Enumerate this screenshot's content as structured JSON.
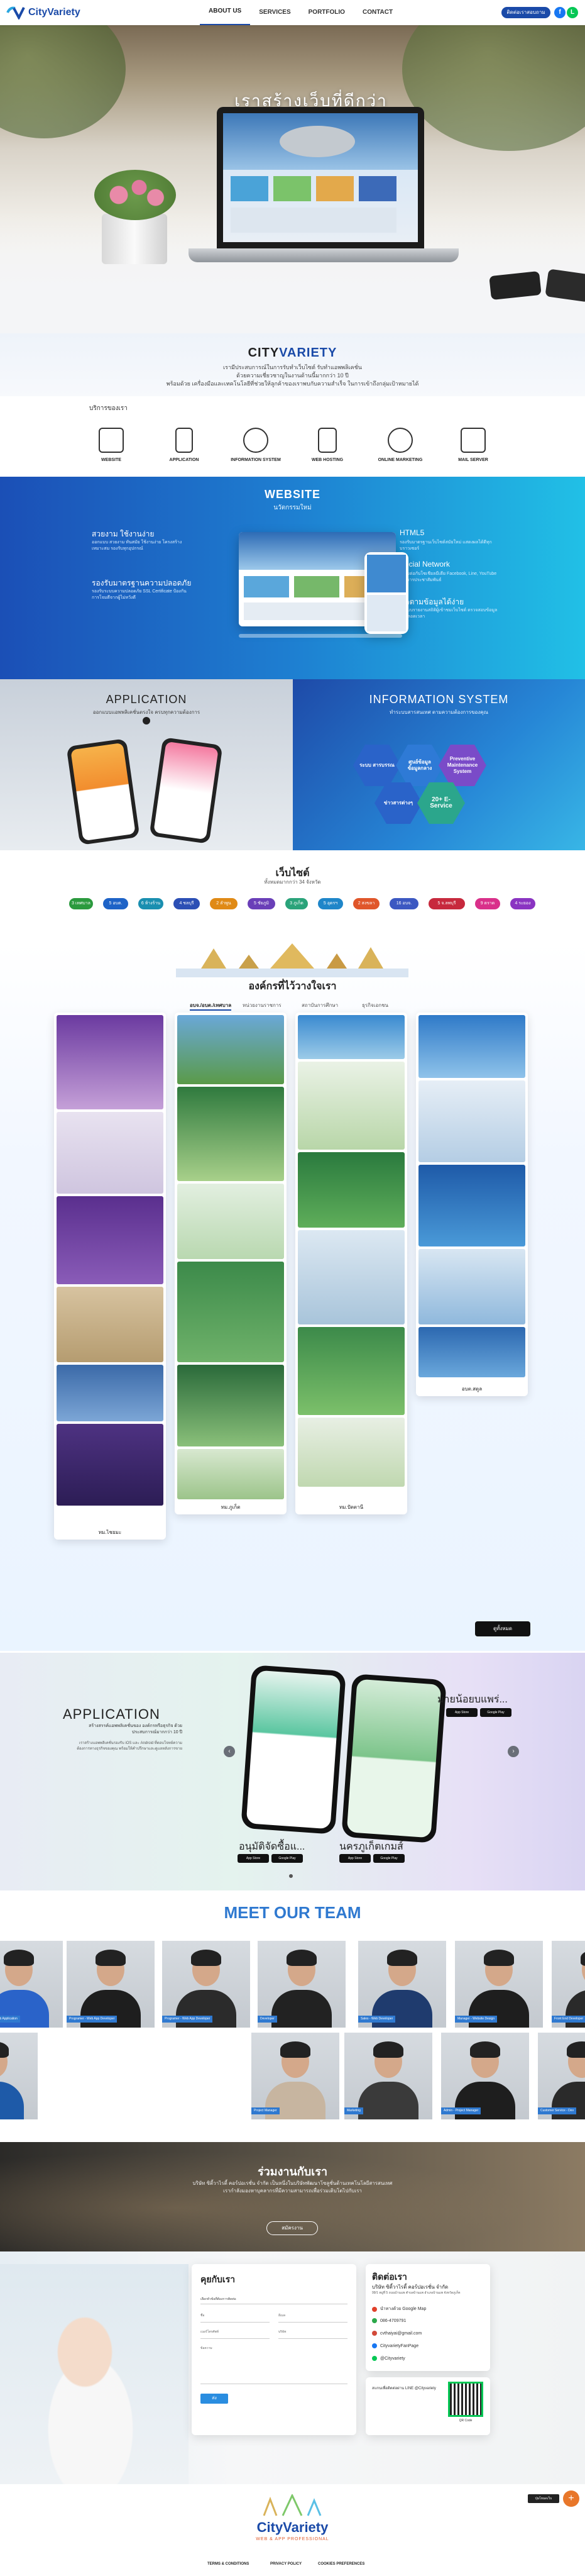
{
  "brand": {
    "logo_text": "CityVariety",
    "accent": "#1a4aa8"
  },
  "nav": {
    "items": [
      "ABOUT US",
      "SERVICES",
      "PORTFOLIO",
      "CONTACT"
    ],
    "contact_button": "ติดต่อเราสอบถาม",
    "social": [
      "f",
      "L",
      "m"
    ]
  },
  "hero": {
    "title": "เราสร้างเว็บที่ดีกว่า"
  },
  "about": {
    "title_city": "CITY",
    "title_variety": "VARIETY",
    "lines": [
      "เรามีประสบการณ์ในการรับทำเว็บไซต์ รับทำแอพพลิเคชั่น",
      "ด้วยความเชี่ยวชาญในงานด้านนี้มากกว่า 10 ปี",
      "พร้อมด้วย เครื่องมือและเทคโนโลยีที่ช่วยให้ลูกค้าของเราพบกับความสำเร็จ ในการเข้าถึงกลุ่มเป้าหมายได้"
    ]
  },
  "services": {
    "title": "บริการของเรา",
    "items": [
      "WEBSITE",
      "APPLICATION",
      "INFORMATION SYSTEM",
      "WEB HOSTING",
      "ONLINE MARKETING",
      "MAIL SERVER"
    ]
  },
  "website": {
    "title": "WEBSITE",
    "subtitle": "นวัตกรรมใหม่",
    "left": [
      {
        "h": "สวยงาม ใช้งานง่าย",
        "p": "ออกแบบ สวยงาม ทันสมัย ใช้งานง่าย โครงสร้างเหมาะสม รองรับทุกอุปกรณ์"
      },
      {
        "h": "รองรับมาตรฐานความปลอดภัย",
        "p": "รองรับระบบความปลอดภัย SSL Certificate ป้องกันการโจมตีจากผู้ไม่หวังดี"
      }
    ],
    "right": [
      {
        "h": "HTML5",
        "p": "รองรับมาตรฐานเว็บไซต์สมัยใหม่ แสดงผลได้ดีทุกบราวเซอร์"
      },
      {
        "h": "Social Network",
        "p": "เชื่อมต่อกับโซเชียลมีเดีย Facebook, Line, YouTube เพื่อการประชาสัมพันธ์"
      },
      {
        "h": "ติดตามข้อมูลได้ง่าย",
        "p": "มีระบบรายงานสถิติผู้เข้าชมเว็บไซต์ ตรวจสอบข้อมูลได้ตลอดเวลา"
      }
    ]
  },
  "application": {
    "title": "APPLICATION",
    "subtitle": "ออกแบบแอพพลิเคชั่นตรงใจ ครบทุกความต้องการ"
  },
  "information": {
    "title": "INFORMATION SYSTEM",
    "subtitle": "ทำระบบสารสนเทศ ตามความต้องการของคุณ",
    "hexes": [
      "ระบบ สารบรรณ",
      "ศูนย์ข้อมูล ข้อมูลกลาง",
      "Preventive Maintenance System",
      "ข่าวสารต่างๆ",
      "20+ E-Service"
    ]
  },
  "websites": {
    "title": "เว็บไซต์",
    "subtitle": "ทั้งหมดมากกว่า 34 จังหวัด",
    "pills": [
      {
        "label": "3 เทศบาล",
        "color": "#2b9a3e"
      },
      {
        "label": "5 อบต.",
        "color": "#1e63c7"
      },
      {
        "label": "6 ห้างร้าน",
        "color": "#1a8fb0"
      },
      {
        "label": "4 ชลบุรี",
        "color": "#2c4fb5"
      },
      {
        "label": "2 ลำพูน",
        "color": "#e08a16"
      },
      {
        "label": "5 ชัยภูมิ",
        "color": "#6a3fb8"
      },
      {
        "label": "3 ภูเก็ต",
        "color": "#2aa37a"
      },
      {
        "label": "5 อุดรฯ",
        "color": "#1f86c9"
      },
      {
        "label": "2 สงขลา",
        "color": "#e0562a"
      },
      {
        "label": "16 อบจ.",
        "color": "#3c58c2"
      },
      {
        "label": "5 จ.ลพบุรี",
        "color": "#c7293d"
      },
      {
        "label": "9 ตราด",
        "color": "#d9308a"
      },
      {
        "label": "4 ระยอง",
        "color": "#8a34c2"
      }
    ]
  },
  "orgs": {
    "title": "องค์กรที่ไว้วางใจเรา",
    "tabs": [
      "อบจ./อบต./เทศบาล",
      "หน่วยงานราชการ",
      "สถาบันการศึกษา",
      "ธุรกิจเอกชน"
    ],
    "cards": [
      "ทม.ไชยมะ",
      "ทม.ภูเก็ต",
      "ทม.ปัตตานี",
      "อบต.สตูล"
    ],
    "more_button": "ดูทั้งหมด"
  },
  "app_banner": {
    "title": "APPLICATION",
    "subtitle": "สร้างสรรค์แอพพลิเคชั่นของ องค์กรหรือธุรกิจ ด้วยประสบการณ์มากกว่า 10 ปี",
    "body": "เราสร้างแอพพลิเคชั่นรองรับ iOS และ Android ที่ตอบโจทย์ความต้องการทางธุรกิจของคุณ พร้อมให้คำปรึกษาและดูแลหลังการขาย",
    "app1": "อนุมัติจัดซื้อแ...",
    "app2": "นครภูเก็ตเกมส์",
    "app3": "มายน้อยบแพร่...",
    "store_ios": "App Store",
    "store_play": "Google Play"
  },
  "team": {
    "title": "MEET OUR TEAM",
    "roles": [
      "Programer - Web Application",
      "Programer - Web App Developer",
      "Programer - Web App Developer",
      "Developer",
      "Sales - Web Developer",
      "Manager - Website Design",
      "Front End Developer",
      "Project Manager",
      "Project Manager",
      "Marketing",
      "Admin - Project Manager",
      "Customer Service - Dev",
      "Web Developer"
    ]
  },
  "join": {
    "title": "ร่วมงานกับเรา",
    "text": "บริษัท ซิตี้วาไรตี้ คอร์ปอเรชั่น จำกัด เป็นหนึ่งในบริษัทพัฒนาโซลูชั่นด้านเทคโนโลยีสารสนเทศ เรากำลังมองหาบุคลากรที่มีความสามารถเพื่อร่วมเติบโตไปกับเรา",
    "button": "สมัครงาน"
  },
  "contact": {
    "form_title": "คุยกับเรา",
    "fields": [
      "เลือกหัวข้อที่ต้องการติดต่อ",
      "ชื่อ",
      "อีเมล",
      "เบอร์โทรศัพท์",
      "บริษัท",
      "ข้อความ"
    ],
    "send": "ส่ง",
    "info_title": "ติดต่อเรา",
    "company": "บริษัท ซิตี้วาไรตี้ คอร์ปอเรชั่น จำกัด",
    "address": "99/1 หมู่ที่ 5 ถนนบ้านแพ ตำบลบ้านแพ อำเภอบ้านแพ จังหวัดภูเก็ต",
    "map": "นำทางด้วย Google Map",
    "phone": "086-4709791",
    "email": "cvthaiyai@gmail.com",
    "facebook": "CityvarietyFanPage",
    "line": "@Cityvariety",
    "qr_text": "สแกนเพื่อติดต่อผ่าน LINE @Cityvariety",
    "qr_label": "QR Code"
  },
  "footer": {
    "brand": "CityVariety",
    "tagline": "WEB & APP PROFESSIONAL",
    "links": [
      "TERMS & CONDITIONS",
      "PRIVACY POLICY",
      "COOKIES PREFERENCES"
    ],
    "badge": "ปุ่มโหมดเว็บ"
  }
}
